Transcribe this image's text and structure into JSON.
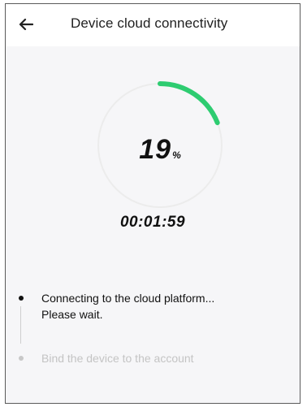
{
  "header": {
    "title": "Device cloud connectivity",
    "back_icon": "arrow-left-icon"
  },
  "progress": {
    "percent": 19,
    "value_text": "19",
    "unit": "%",
    "ring_color": "#2ecc71",
    "track_color": "#ececec"
  },
  "timer": {
    "value": "00:01:59"
  },
  "steps": [
    {
      "label_line1": "Connecting to the cloud platform...",
      "label_line2": "Please wait.",
      "state": "active"
    },
    {
      "label": "Bind the device to the account",
      "state": "pending"
    }
  ]
}
